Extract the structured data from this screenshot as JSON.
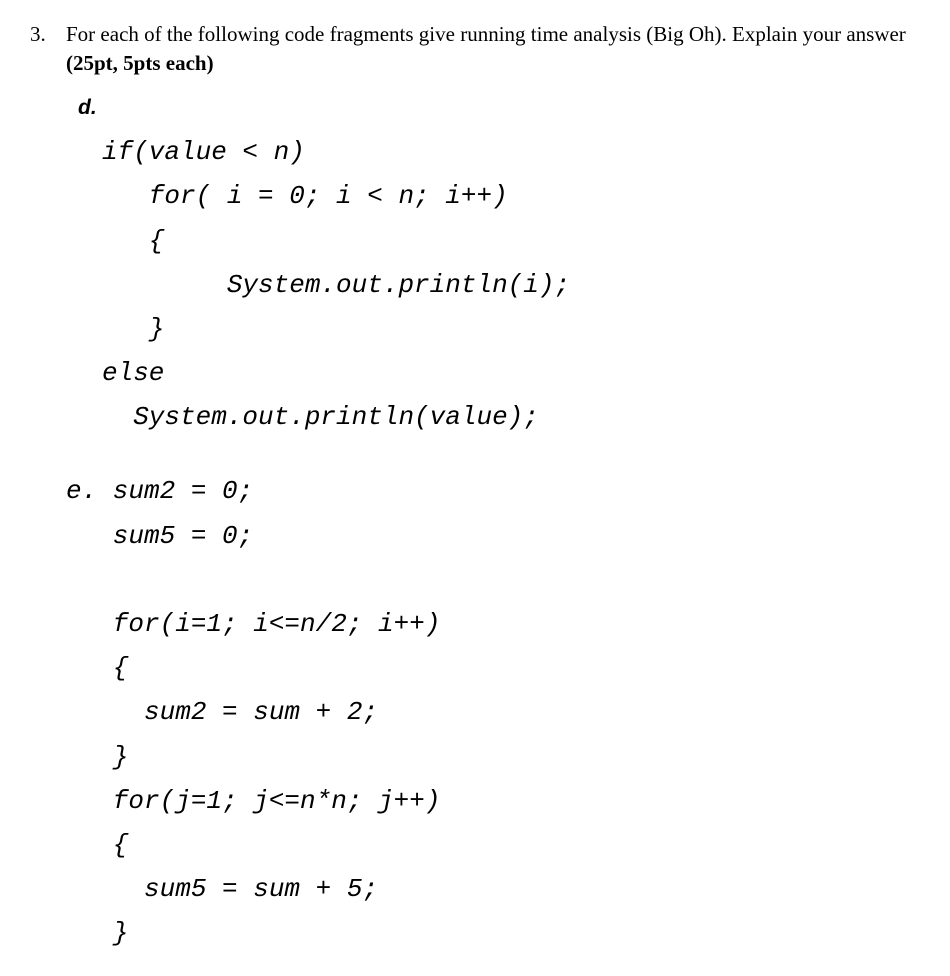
{
  "question": {
    "number": "3.",
    "text_part1": "For each of the following code fragments give running time analysis (Big Oh). Explain your answer ",
    "text_bold": "(25pt, 5pts each)"
  },
  "part_d": {
    "label": "d.",
    "code": "if(value < n)\n   for( i = 0; i < n; i++)\n   {\n        System.out.println(i);\n   }\nelse\n  System.out.println(value);"
  },
  "part_e": {
    "code": "e. sum2 = 0;\n   sum5 = 0;\n\n   for(i=1; i<=n/2; i++)\n   {\n     sum2 = sum + 2;\n   }\n   for(j=1; j<=n*n; j++)\n   {\n     sum5 = sum + 5;\n   }"
  }
}
